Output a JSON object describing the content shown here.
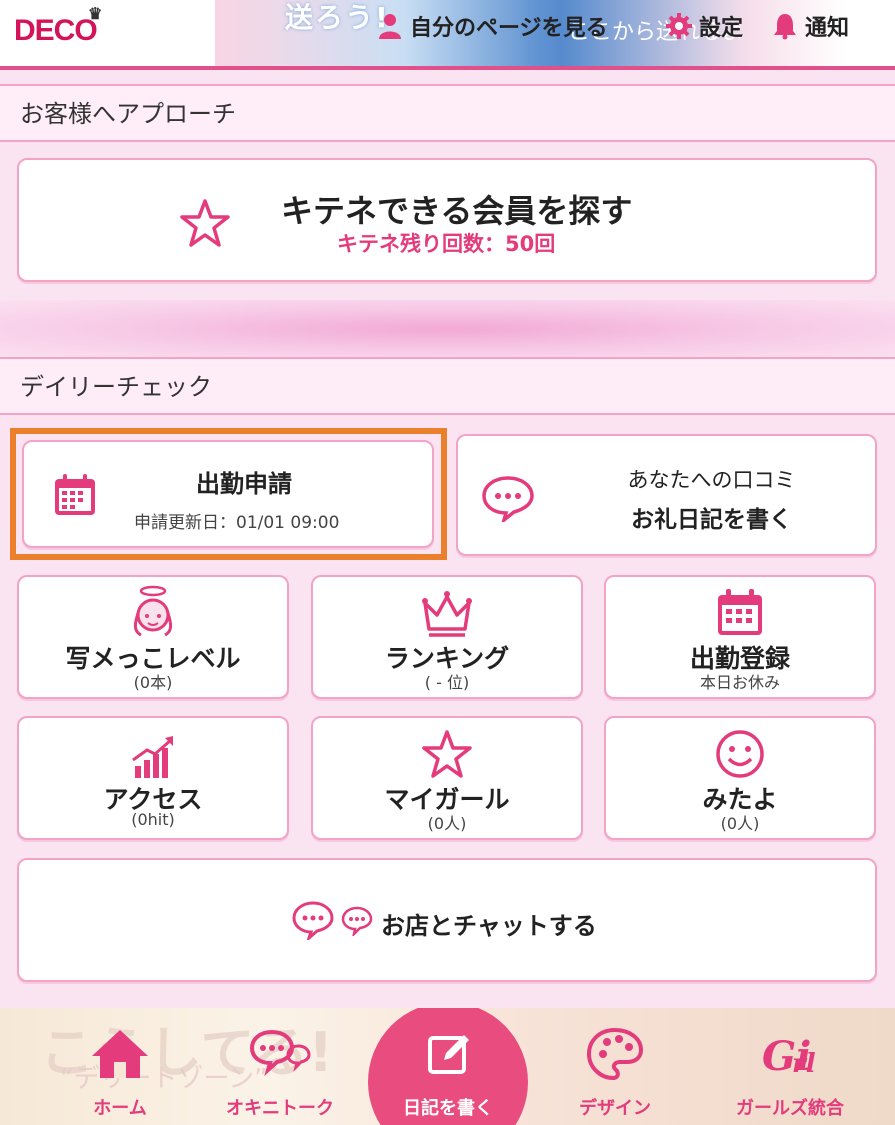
{
  "header": {
    "logo": "DECO",
    "banner_text1": "送ろう!",
    "banner_text2": "ここから送れるよ",
    "my_page": "自分のページを見る",
    "settings": "設定",
    "notify": "通知"
  },
  "approach": {
    "title": "お客様へアプローチ",
    "search_title": "キテネできる会員を探す",
    "search_sub": "キテネ残り回数：50回"
  },
  "daily": {
    "title": "デイリーチェック",
    "apply_title": "出勤申請",
    "apply_sub": "申請更新日：01/01 09:00",
    "review_line1": "あなたへの口コミ",
    "review_line2": "お礼日記を書く",
    "tiles": [
      {
        "label": "写メっこレベル",
        "count": "(0本)"
      },
      {
        "label": "ランキング",
        "count": "( - 位)"
      },
      {
        "label": "出勤登録",
        "count": "本日お休み"
      },
      {
        "label": "アクセス",
        "count": "(0hit)"
      },
      {
        "label": "マイガール",
        "count": "(0人)"
      },
      {
        "label": "みたよ",
        "count": "(0人)"
      }
    ],
    "chat_label": "お店とチャットする"
  },
  "tabbar": {
    "ghost1": "こうしてる!",
    "ghost2": "“デリートゾーン”",
    "home": "ホーム",
    "fav": "オキニトーク",
    "write": "日記を書く",
    "design": "デザイン",
    "girls": "ガールズ統合"
  },
  "colors": {
    "accent": "#e33b7c",
    "border": "#f2a3c6",
    "highlight": "#ea7f2c"
  }
}
